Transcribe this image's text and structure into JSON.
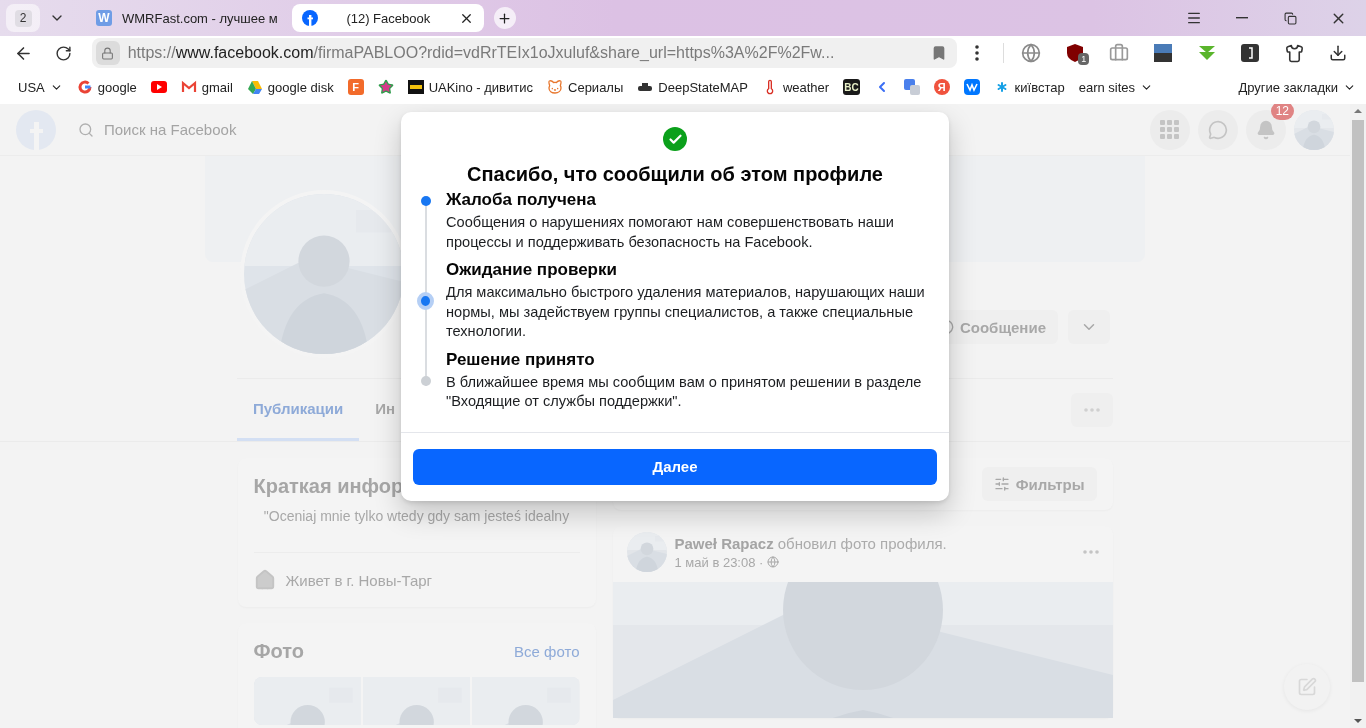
{
  "browser": {
    "tab_count": "2",
    "tabs": [
      {
        "title": "WMRFast.com - лучшее м",
        "favicon_glyph": "W",
        "selected": false
      },
      {
        "title": "(12) Facebook",
        "selected": true
      }
    ],
    "url": {
      "scheme": "https://",
      "domain": "www.facebook.com",
      "path": "/firmaPABLOO?rdid=vdRrTEIx1oJxuluf&share_url=https%3A%2F%2Fw..."
    },
    "extension_badge": "1",
    "bookmarks": [
      {
        "kind": "folder",
        "label": "USA"
      },
      {
        "kind": "link",
        "label": "google"
      },
      {
        "kind": "icon"
      },
      {
        "kind": "link",
        "label": "gmail"
      },
      {
        "kind": "link",
        "label": "google disk"
      },
      {
        "kind": "icon",
        "glyph": "F"
      },
      {
        "kind": "icon"
      },
      {
        "kind": "link",
        "label": "UAKino - дивитис"
      },
      {
        "kind": "link",
        "label": "Сериалы"
      },
      {
        "kind": "link",
        "label": "DeepStateMAP"
      },
      {
        "kind": "link",
        "label": "weather"
      },
      {
        "kind": "icon",
        "glyph": "BC"
      },
      {
        "kind": "icon"
      },
      {
        "kind": "icon"
      },
      {
        "kind": "icon",
        "glyph": "Я"
      },
      {
        "kind": "icon"
      },
      {
        "kind": "link",
        "label": "київстар"
      },
      {
        "kind": "folder",
        "label": "earn sites"
      }
    ],
    "other_bookmarks": {
      "label": "Другие закладки"
    }
  },
  "facebook": {
    "search": {
      "placeholder": "Поиск на Facebook"
    },
    "notification_count": "12",
    "message_button": "Сообщение",
    "tabs": [
      {
        "label": "Публикации",
        "selected": true
      },
      {
        "label": "Ин",
        "selected": false
      }
    ],
    "intro": {
      "title": "Краткая инфор",
      "quote": "\"Oceniaj mnie tylko wtedy gdy sam jesteś idealny",
      "lives_in": "Живет в г. Новы-Тарг"
    },
    "photos": {
      "title": "Фото",
      "all_link": "Все фото"
    },
    "filters_button": "Фильтры",
    "post": {
      "author": "Paweł Rapacz",
      "action": "обновил фото профиля.",
      "time": "1 май в 23:08 ·"
    }
  },
  "dialog": {
    "title": "Спасибо, что сообщили об этом профиле",
    "steps": [
      {
        "title": "Жалоба получена",
        "text": "Сообщения о нарушениях помогают нам совершенствовать наши процессы и поддерживать безопасность на Facebook.",
        "completed": true,
        "current": false
      },
      {
        "title": "Ожидание проверки",
        "text": "Для максимально быстрого удаления материалов, нарушающих наши нормы, мы задействуем группы специалистов, а также специальные технологии.",
        "completed": false,
        "current": true
      },
      {
        "title": "Решение принято",
        "text": "В ближайшее время мы сообщим вам о принятом решении в разделе \"Входящие от службы поддержки\".",
        "completed": false,
        "current": false
      }
    ],
    "button": "Далее"
  }
}
